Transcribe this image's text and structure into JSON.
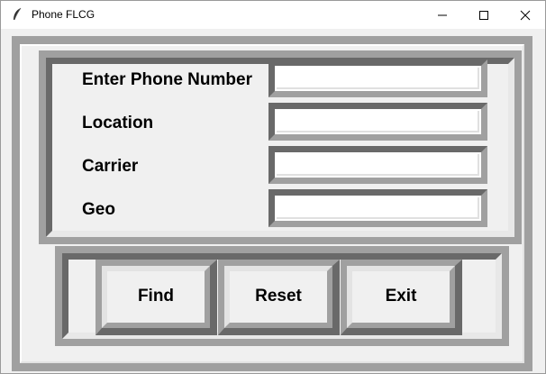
{
  "window": {
    "title": "Phone FLCG"
  },
  "form": {
    "fields": [
      {
        "label": "Enter Phone Number",
        "value": ""
      },
      {
        "label": "Location",
        "value": ""
      },
      {
        "label": "Carrier",
        "value": ""
      },
      {
        "label": "Geo",
        "value": ""
      }
    ]
  },
  "buttons": {
    "find_label": "Find",
    "reset_label": "Reset",
    "exit_label": "Exit"
  },
  "colors": {
    "frame_light": "#ffffff",
    "frame_mid": "#a0a0a0",
    "frame_dark": "#696969",
    "background": "#f0f0f0"
  }
}
